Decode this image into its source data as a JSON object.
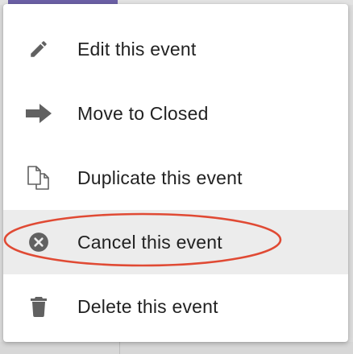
{
  "menu": {
    "items": [
      {
        "label": "Edit this event",
        "icon": "pencil-icon"
      },
      {
        "label": "Move to Closed",
        "icon": "arrow-right-icon"
      },
      {
        "label": "Duplicate this event",
        "icon": "duplicate-icon"
      },
      {
        "label": "Cancel this event",
        "icon": "cancel-circle-icon",
        "highlighted": true
      },
      {
        "label": "Delete this event",
        "icon": "trash-icon"
      }
    ]
  },
  "colors": {
    "icon": "#616161",
    "text": "#222222",
    "highlight": "#ececec",
    "annotation": "#e04a34",
    "accent": "#6b5fa5"
  }
}
